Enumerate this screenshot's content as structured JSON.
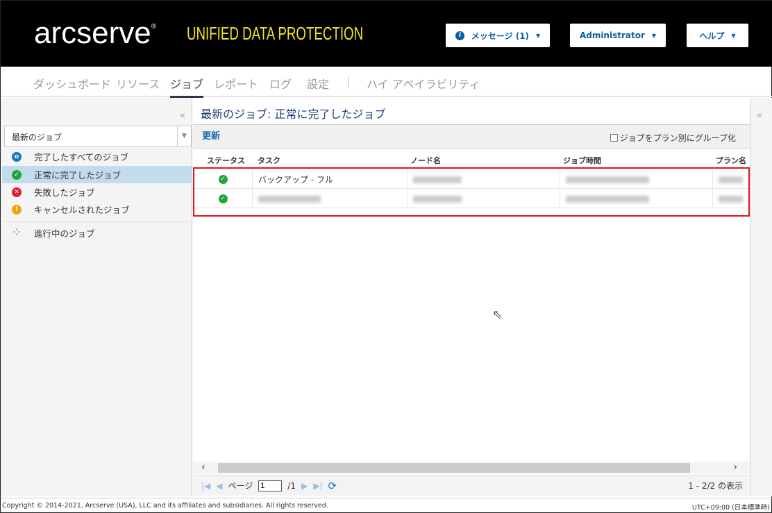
{
  "header": {
    "logo": "arcserve",
    "product": "UNIFIED DATA PROTECTION",
    "messages": "メッセージ (1)",
    "user": "Administrator",
    "help": "ヘルプ"
  },
  "nav": [
    "ダッシュボード",
    "リソース",
    "ジョブ",
    "レポート",
    "ログ",
    "設定",
    "|",
    "ハイ アベイラビリティ"
  ],
  "sidebar": {
    "select": "最新のジョブ",
    "items": [
      {
        "label": "完了したすべてのジョブ",
        "color": "#1a7ac4"
      },
      {
        "label": "正常に完了したジョブ",
        "color": "#20a53a"
      },
      {
        "label": "失敗したジョブ",
        "color": "#d9213a"
      },
      {
        "label": "キャンセルされたジョブ",
        "color": "#f0a30a"
      }
    ],
    "inprogress": "進行中のジョブ"
  },
  "main": {
    "title": "最新のジョブ: 正常に完了したジョブ",
    "refresh": "更新",
    "group_by_plan": "ジョブをプラン別にグループ化",
    "columns": [
      "ステータス",
      "タスク",
      "ノード名",
      "ジョブ時間",
      "プラン名"
    ],
    "rows": [
      {
        "task": "バックアップ - フル"
      },
      {
        "task": ""
      }
    ]
  },
  "pager": {
    "page_label": "ページ",
    "page": "1",
    "of": "/1",
    "summary": "1 - 2/2 の表示"
  },
  "footer": {
    "copyright": "Copyright © 2014-2021, Arcserve (USA), LLC and its affiliates and subsidiaries. All rights reserved.",
    "timezone": "UTC+09:00 (日本標準時)"
  }
}
